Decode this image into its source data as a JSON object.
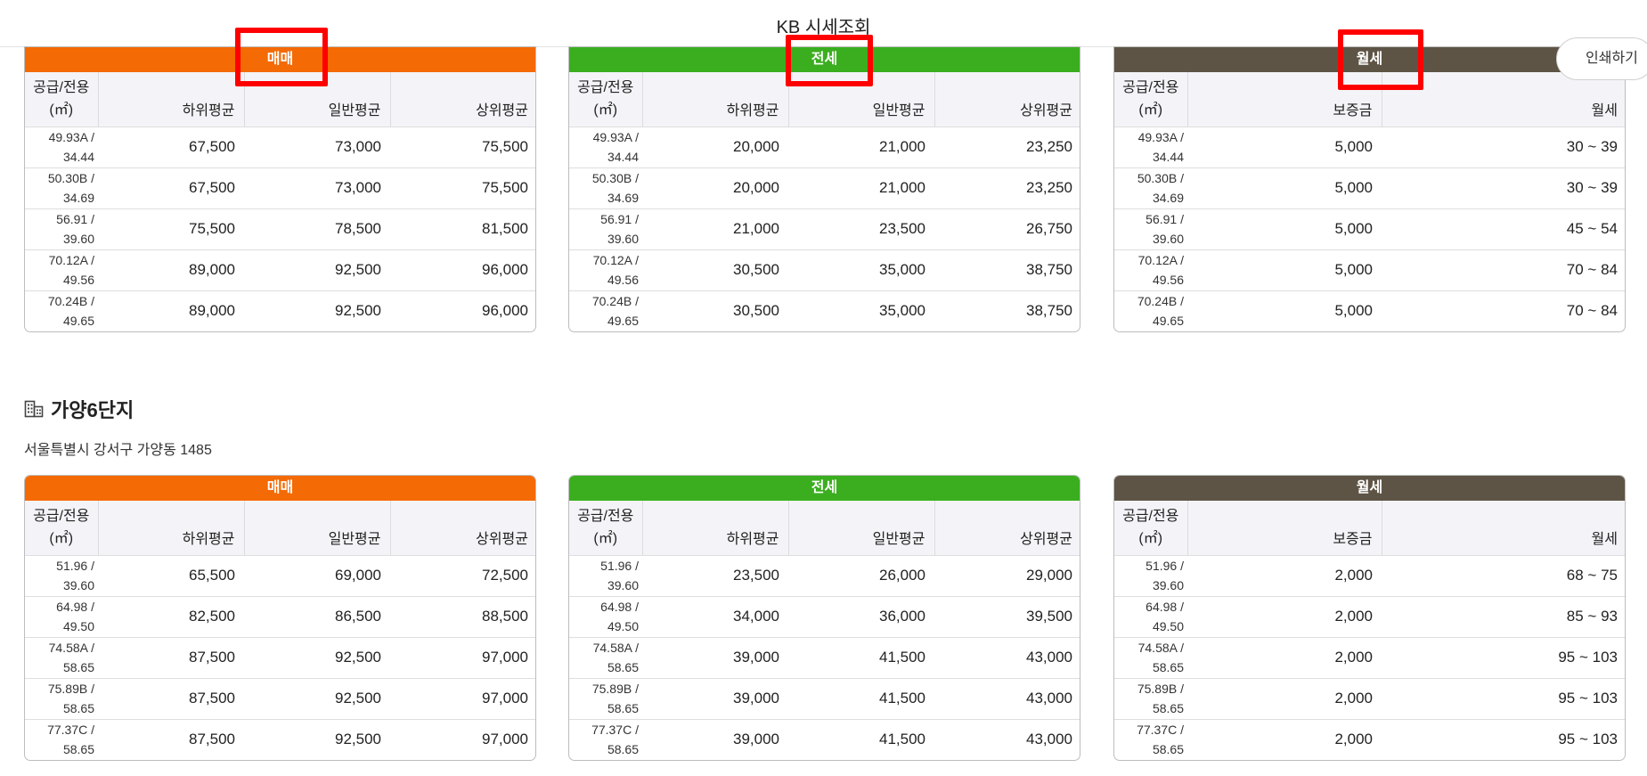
{
  "header": {
    "title": "KB 시세조회",
    "print_label": "인쇄하기"
  },
  "colors": {
    "sale": "#f46a04",
    "jeonse": "#3aae1f",
    "monthly": "#5e5445",
    "highlight": "#ff0000"
  },
  "complexes": [
    {
      "sale": {
        "title": "매매",
        "columns": [
          "공급/전용\n(㎡)",
          "하위평균",
          "일반평균",
          "상위평균"
        ],
        "rows": [
          [
            "49.93A /\n34.44",
            "67,500",
            "73,000",
            "75,500"
          ],
          [
            "50.30B /\n34.69",
            "67,500",
            "73,000",
            "75,500"
          ],
          [
            "56.91 /\n39.60",
            "75,500",
            "78,500",
            "81,500"
          ],
          [
            "70.12A /\n49.56",
            "89,000",
            "92,500",
            "96,000"
          ],
          [
            "70.24B /\n49.65",
            "89,000",
            "92,500",
            "96,000"
          ]
        ]
      },
      "jeonse": {
        "title": "전세",
        "columns": [
          "공급/전용\n(㎡)",
          "하위평균",
          "일반평균",
          "상위평균"
        ],
        "rows": [
          [
            "49.93A /\n34.44",
            "20,000",
            "21,000",
            "23,250"
          ],
          [
            "50.30B /\n34.69",
            "20,000",
            "21,000",
            "23,250"
          ],
          [
            "56.91 /\n39.60",
            "21,000",
            "23,500",
            "26,750"
          ],
          [
            "70.12A /\n49.56",
            "30,500",
            "35,000",
            "38,750"
          ],
          [
            "70.24B /\n49.65",
            "30,500",
            "35,000",
            "38,750"
          ]
        ]
      },
      "monthly": {
        "title": "월세",
        "columns": [
          "공급/전용\n(㎡)",
          "보증금",
          "월세"
        ],
        "rows": [
          [
            "49.93A /\n34.44",
            "5,000",
            "30 ~ 39"
          ],
          [
            "50.30B /\n34.69",
            "5,000",
            "30 ~ 39"
          ],
          [
            "56.91 /\n39.60",
            "5,000",
            "45 ~ 54"
          ],
          [
            "70.12A /\n49.56",
            "5,000",
            "70 ~ 84"
          ],
          [
            "70.24B /\n49.65",
            "5,000",
            "70 ~ 84"
          ]
        ]
      }
    },
    {
      "name": "가양6단지",
      "address": "서울특별시 강서구 가양동 1485",
      "sale": {
        "title": "매매",
        "columns": [
          "공급/전용\n(㎡)",
          "하위평균",
          "일반평균",
          "상위평균"
        ],
        "rows": [
          [
            "51.96 /\n39.60",
            "65,500",
            "69,000",
            "72,500"
          ],
          [
            "64.98 /\n49.50",
            "82,500",
            "86,500",
            "88,500"
          ],
          [
            "74.58A /\n58.65",
            "87,500",
            "92,500",
            "97,000"
          ],
          [
            "75.89B /\n58.65",
            "87,500",
            "92,500",
            "97,000"
          ],
          [
            "77.37C /\n58.65",
            "87,500",
            "92,500",
            "97,000"
          ]
        ]
      },
      "jeonse": {
        "title": "전세",
        "columns": [
          "공급/전용\n(㎡)",
          "하위평균",
          "일반평균",
          "상위평균"
        ],
        "rows": [
          [
            "51.96 /\n39.60",
            "23,500",
            "26,000",
            "29,000"
          ],
          [
            "64.98 /\n49.50",
            "34,000",
            "36,000",
            "39,500"
          ],
          [
            "74.58A /\n58.65",
            "39,000",
            "41,500",
            "43,000"
          ],
          [
            "75.89B /\n58.65",
            "39,000",
            "41,500",
            "43,000"
          ],
          [
            "77.37C /\n58.65",
            "39,000",
            "41,500",
            "43,000"
          ]
        ]
      },
      "monthly": {
        "title": "월세",
        "columns": [
          "공급/전용\n(㎡)",
          "보증금",
          "월세"
        ],
        "rows": [
          [
            "51.96 /\n39.60",
            "2,000",
            "68 ~ 75"
          ],
          [
            "64.98 /\n49.50",
            "2,000",
            "85 ~ 93"
          ],
          [
            "74.58A /\n58.65",
            "2,000",
            "95 ~ 103"
          ],
          [
            "75.89B /\n58.65",
            "2,000",
            "95 ~ 103"
          ],
          [
            "77.37C /\n58.65",
            "2,000",
            "95 ~ 103"
          ]
        ]
      }
    }
  ]
}
